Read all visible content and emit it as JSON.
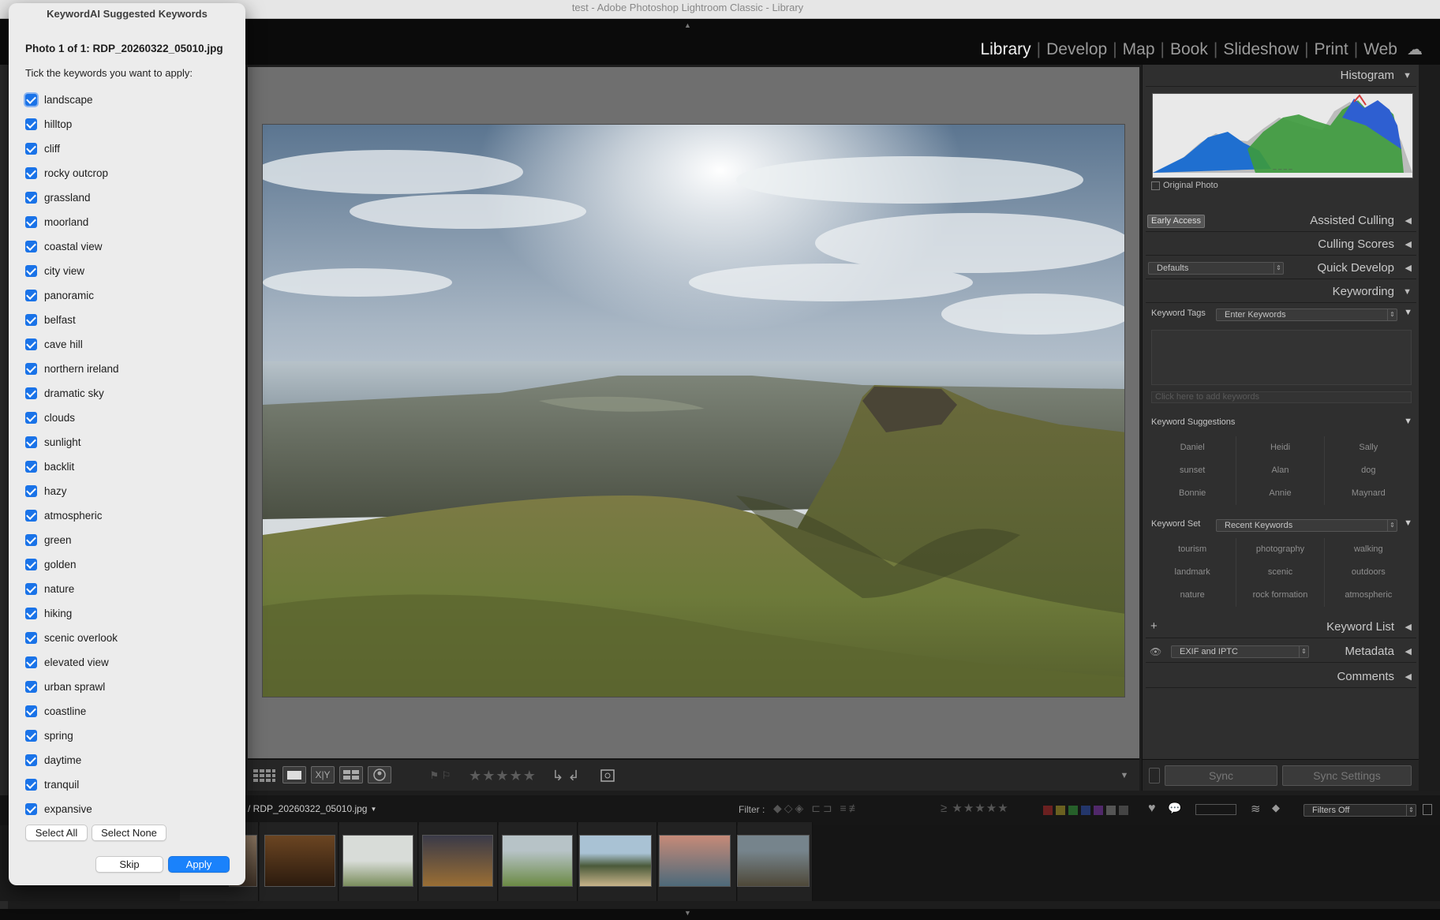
{
  "window_title": "test - Adobe Photoshop Lightroom Classic - Library",
  "modules": [
    "Library",
    "Develop",
    "Map",
    "Book",
    "Slideshow",
    "Print",
    "Web"
  ],
  "active_module": "Library",
  "dialog": {
    "title": "KeywordAI Suggested Keywords",
    "photo_label": "Photo 1 of 1: RDP_20260322_05010.jpg",
    "instruction": "Tick the keywords you want to apply:",
    "keywords": [
      {
        "label": "landscape",
        "checked": true
      },
      {
        "label": "hilltop",
        "checked": true
      },
      {
        "label": "cliff",
        "checked": true
      },
      {
        "label": "rocky outcrop",
        "checked": true
      },
      {
        "label": "grassland",
        "checked": true
      },
      {
        "label": "moorland",
        "checked": true
      },
      {
        "label": "coastal view",
        "checked": true
      },
      {
        "label": "city view",
        "checked": true
      },
      {
        "label": "panoramic",
        "checked": true
      },
      {
        "label": "belfast",
        "checked": true
      },
      {
        "label": "cave hill",
        "checked": true
      },
      {
        "label": "northern ireland",
        "checked": true
      },
      {
        "label": "dramatic sky",
        "checked": true
      },
      {
        "label": "clouds",
        "checked": true
      },
      {
        "label": "sunlight",
        "checked": true
      },
      {
        "label": "backlit",
        "checked": true
      },
      {
        "label": "hazy",
        "checked": true
      },
      {
        "label": "atmospheric",
        "checked": true
      },
      {
        "label": "green",
        "checked": true
      },
      {
        "label": "golden",
        "checked": true
      },
      {
        "label": "nature",
        "checked": true
      },
      {
        "label": "hiking",
        "checked": true
      },
      {
        "label": "scenic overlook",
        "checked": true
      },
      {
        "label": "elevated view",
        "checked": true
      },
      {
        "label": "urban sprawl",
        "checked": true
      },
      {
        "label": "coastline",
        "checked": true
      },
      {
        "label": "spring",
        "checked": true
      },
      {
        "label": "daytime",
        "checked": true
      },
      {
        "label": "tranquil",
        "checked": true
      },
      {
        "label": "expansive",
        "checked": true
      }
    ],
    "select_all": "Select All",
    "select_none": "Select None",
    "skip": "Skip",
    "apply": "Apply"
  },
  "right_panel": {
    "histogram": "Histogram",
    "original_photo": "Original Photo",
    "early_access": "Early Access",
    "assisted_culling": "Assisted Culling",
    "culling_scores": "Culling Scores",
    "defaults": "Defaults",
    "quick_develop": "Quick Develop",
    "keywording": "Keywording",
    "keyword_tags_label": "Keyword Tags",
    "keyword_tags_value": "Enter Keywords",
    "add_keywords_placeholder": "Click here to add keywords",
    "keyword_suggestions": "Keyword Suggestions",
    "suggestions": [
      "Daniel",
      "Heidi",
      "Sally",
      "sunset",
      "Alan",
      "dog",
      "Bonnie",
      "Annie",
      "Maynard"
    ],
    "keyword_set_label": "Keyword Set",
    "keyword_set_value": "Recent Keywords",
    "keyword_set": [
      "tourism",
      "photography",
      "walking",
      "landmark",
      "scenic",
      "outdoors",
      "nature",
      "rock formation",
      "atmospheric"
    ],
    "keyword_list": "Keyword List",
    "metadata_preset": "EXIF and IPTC",
    "metadata": "Metadata",
    "comments": "Comments",
    "sync": "Sync",
    "sync_settings": "Sync Settings"
  },
  "filmstrip": {
    "filename": "RDP_20260322_05010.jpg",
    "filter_label": "Filter :",
    "filters_off": "Filters Off"
  },
  "colors": {
    "accent": "#1a82fb",
    "panel": "#2f2f2f"
  }
}
